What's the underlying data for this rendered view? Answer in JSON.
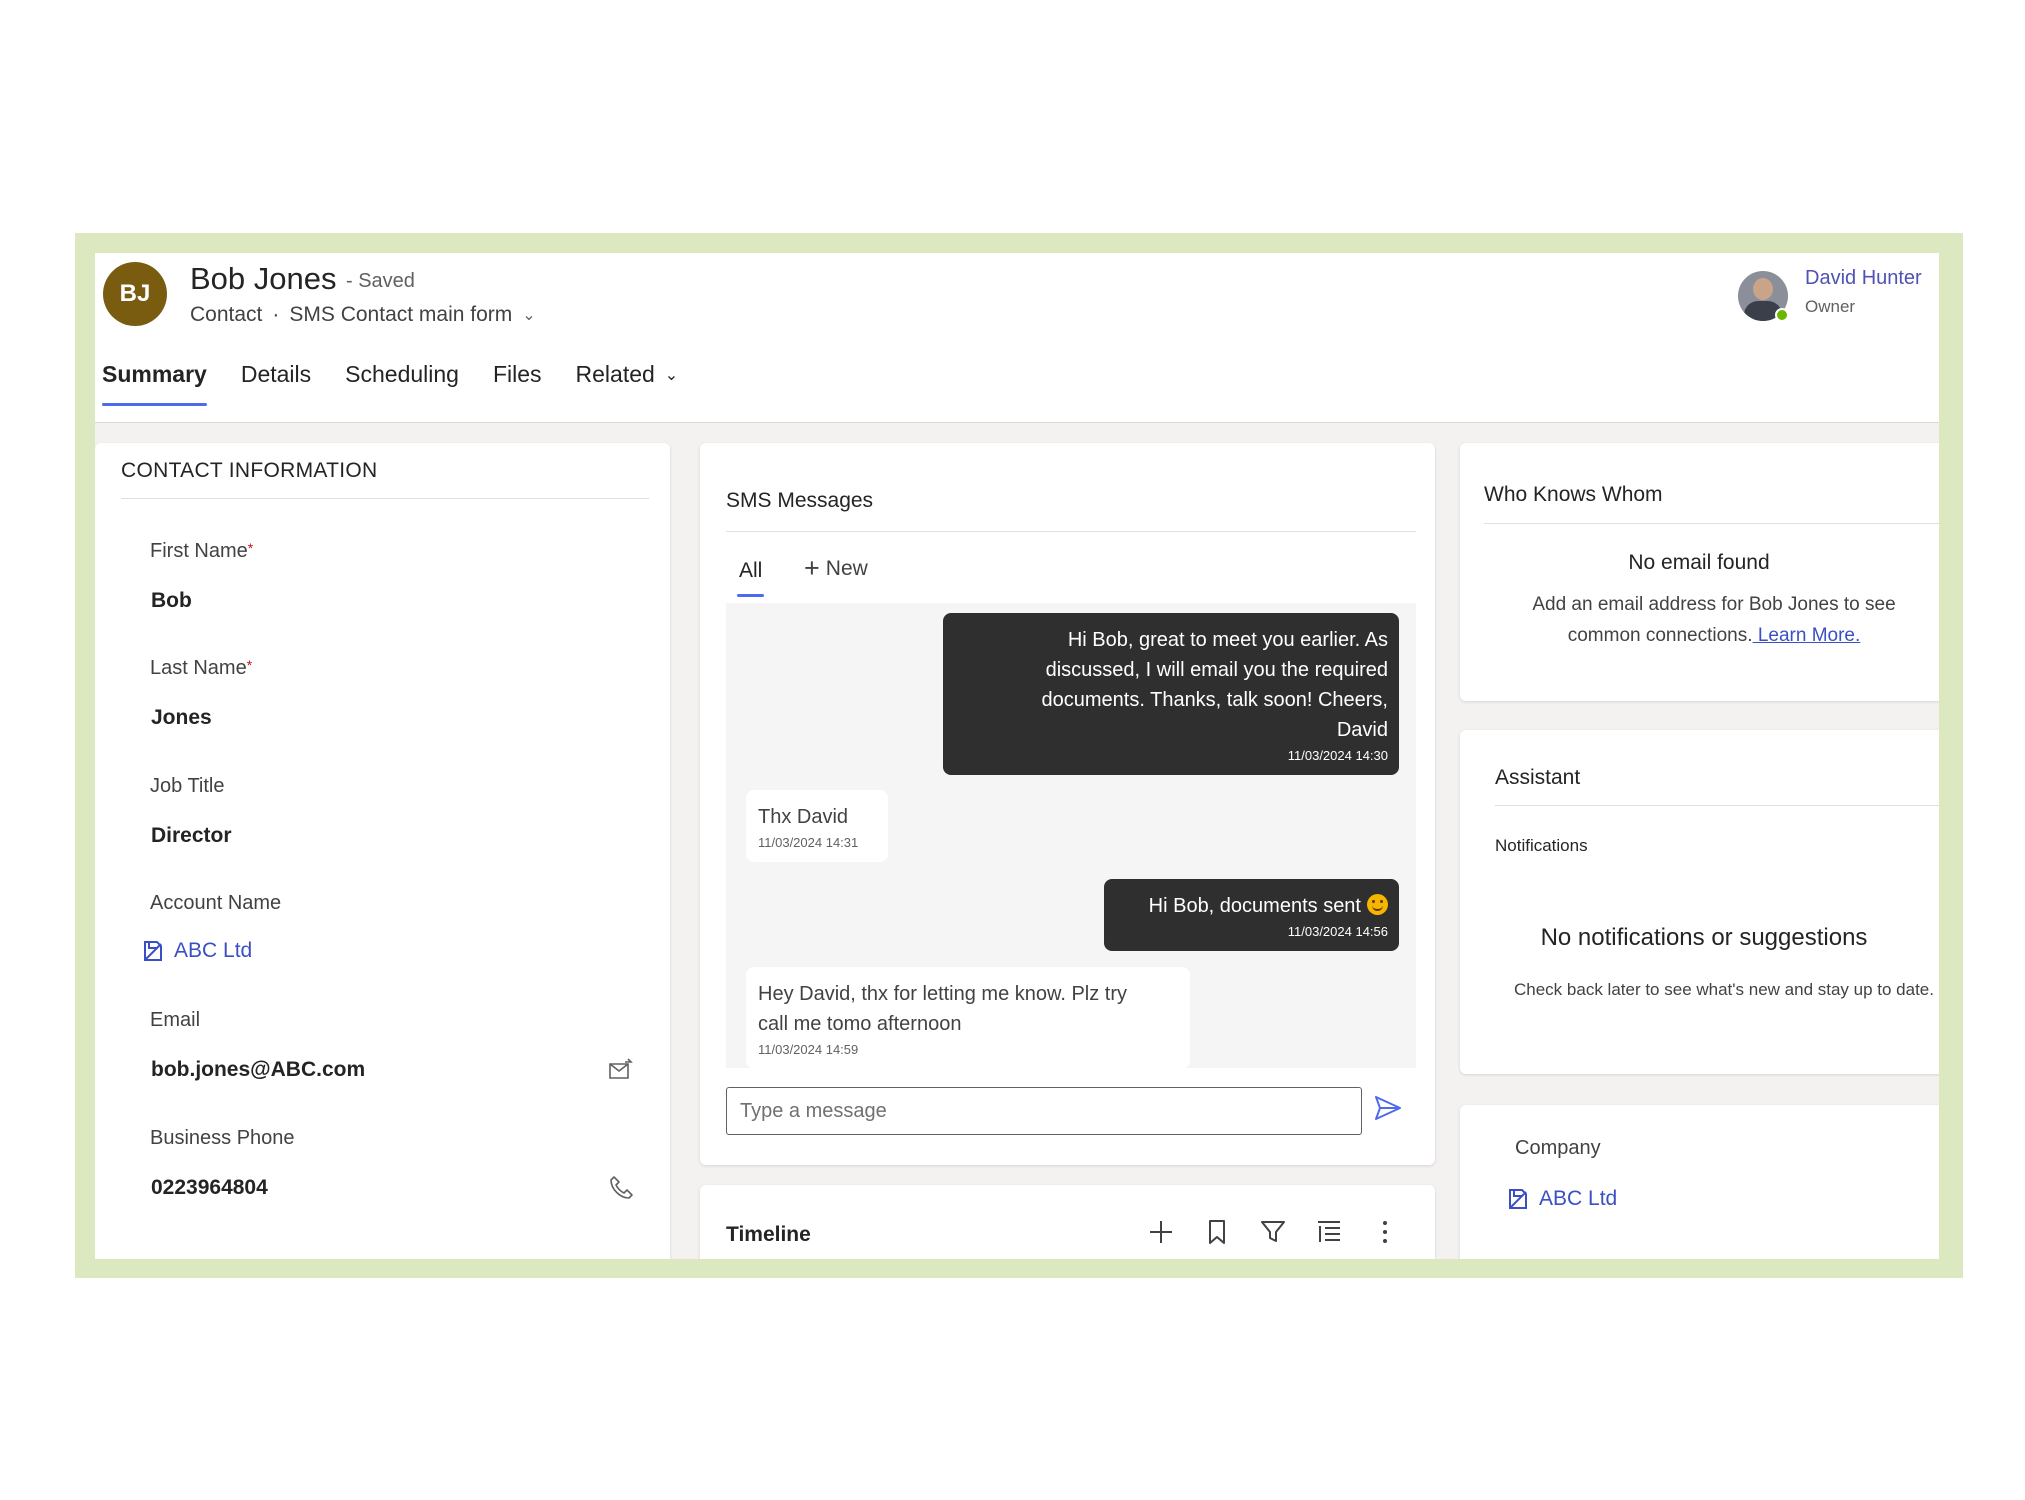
{
  "record": {
    "initials": "BJ",
    "name": "Bob Jones",
    "saved": "- Saved",
    "entity": "Contact",
    "separator": "·",
    "form": "SMS Contact main form"
  },
  "owner": {
    "name": "David Hunter",
    "role": "Owner"
  },
  "tabs": [
    {
      "label": "Summary",
      "active": true
    },
    {
      "label": "Details"
    },
    {
      "label": "Scheduling"
    },
    {
      "label": "Files"
    },
    {
      "label": "Related"
    }
  ],
  "contact": {
    "title": "CONTACT INFORMATION",
    "fields": {
      "first_name": {
        "label": "First Name",
        "required": "*",
        "value": "Bob"
      },
      "last_name": {
        "label": "Last Name",
        "required": "*",
        "value": "Jones"
      },
      "job_title": {
        "label": "Job Title",
        "value": "Director"
      },
      "account_name": {
        "label": "Account Name",
        "value": "ABC Ltd"
      },
      "email": {
        "label": "Email",
        "value": "bob.jones@ABC.com"
      },
      "business_phone": {
        "label": "Business Phone",
        "value": "0223964804"
      }
    }
  },
  "sms": {
    "title": "SMS Messages",
    "tab_all": "All",
    "new_label": "New",
    "messages": [
      {
        "direction": "out",
        "lines": [
          "Hi Bob, great to meet you earlier. As",
          "discussed, I will email you the required",
          "documents. Thanks, talk soon! Cheers,",
          "David"
        ],
        "time": "11/03/2024 14:30"
      },
      {
        "direction": "in",
        "lines": [
          "Thx David"
        ],
        "time": "11/03/2024 14:31"
      },
      {
        "direction": "out",
        "lines": [
          "Hi Bob, documents sent"
        ],
        "emoji": "smiley",
        "time": "11/03/2024 14:56"
      },
      {
        "direction": "in",
        "lines": [
          "Hey David, thx for letting me know. Plz try",
          "call me tomo afternoon"
        ],
        "time": "11/03/2024 14:59"
      }
    ],
    "input_placeholder": "Type a message"
  },
  "timeline": {
    "title": "Timeline"
  },
  "who_knows_whom": {
    "title": "Who Knows Whom",
    "heading": "No email found",
    "text_line1": "Add an email address for Bob Jones to see",
    "text_line2": "common connections.",
    "link": " Learn More."
  },
  "assistant": {
    "title": "Assistant",
    "notifications": "Notifications",
    "heading": "No notifications or suggestions",
    "text": "Check back later to see what's new and stay up to date."
  },
  "company": {
    "label": "Company",
    "value": "ABC Ltd"
  },
  "colors": {
    "frame": "#dbe8c0",
    "accent": "#4f6bed",
    "link": "#3b4fc4",
    "avatar": "#7a5c10",
    "outgoing_bubble": "#2f2f2f",
    "presence": "#6bb700"
  }
}
